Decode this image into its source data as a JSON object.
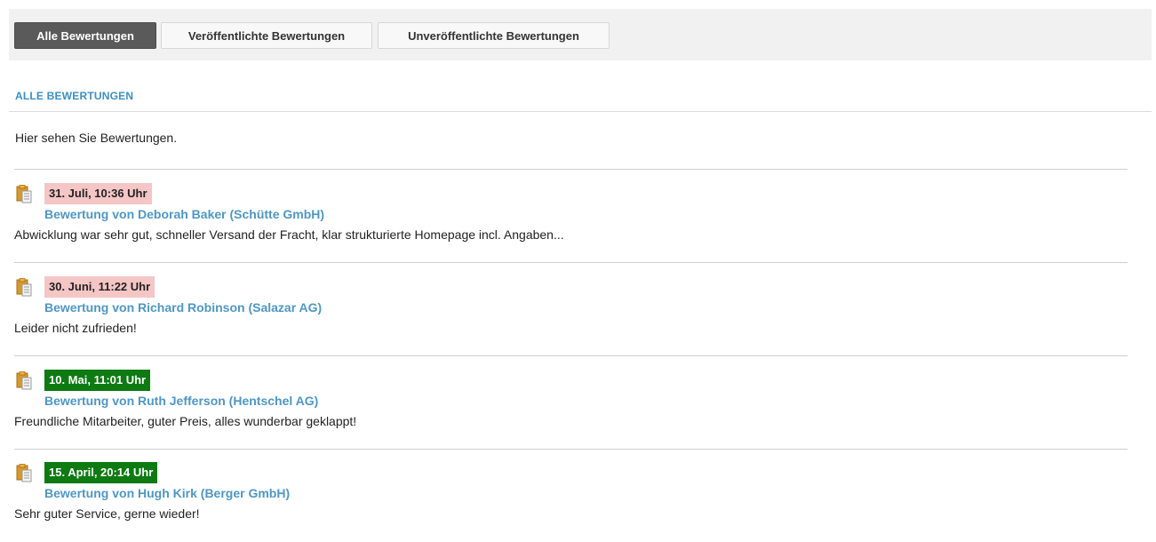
{
  "tabs": [
    {
      "label": "Alle Bewertungen",
      "active": true
    },
    {
      "label": "Veröffentlichte Bewertungen",
      "active": false
    },
    {
      "label": "Unveröffentlichte Bewertungen",
      "active": false
    }
  ],
  "section": {
    "title": "ALLE BEWERTUNGEN",
    "intro": "Hier sehen Sie Bewertungen."
  },
  "reviews": [
    {
      "date": "31. Juli, 10:36 Uhr",
      "status": "unpublished",
      "title": "Bewertung von Deborah Baker (Schütte GmbH)",
      "excerpt": "Abwicklung war sehr gut, schneller Versand der Fracht, klar strukturierte Homepage incl. Angaben..."
    },
    {
      "date": "30. Juni, 11:22 Uhr",
      "status": "unpublished",
      "title": "Bewertung von Richard Robinson (Salazar AG)",
      "excerpt": "Leider nicht zufrieden!"
    },
    {
      "date": "10. Mai, 11:01 Uhr",
      "status": "published",
      "title": "Bewertung von Ruth Jefferson (Hentschel AG)",
      "excerpt": "Freundliche Mitarbeiter, guter Preis, alles wunderbar geklappt!"
    },
    {
      "date": "15. April, 20:14 Uhr",
      "status": "published",
      "title": "Bewertung von Hugh Kirk (Berger GmbH)",
      "excerpt": "Sehr guter Service, gerne wieder!"
    }
  ],
  "colors": {
    "accent": "#3b8fc4",
    "link": "#4e97c6",
    "unpublished_badge": "#f5c6c6",
    "published_badge": "#0d7a12"
  },
  "icons": {
    "review_icon": "clipboard-icon"
  }
}
